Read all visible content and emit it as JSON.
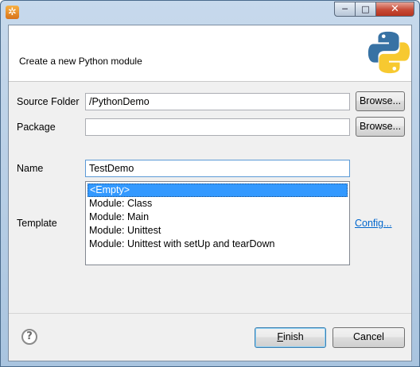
{
  "window": {
    "title": "",
    "controls": {
      "minimize": "─",
      "maximize": "□",
      "close": "✕"
    },
    "app_icon_glyph": "✲"
  },
  "header": {
    "title": "Create a new Python module",
    "logo_icon": "python-logo-icon"
  },
  "form": {
    "source_folder": {
      "label": "Source Folder",
      "value": "/PythonDemo",
      "browse": "Browse..."
    },
    "package": {
      "label": "Package",
      "value": "",
      "browse": "Browse..."
    },
    "name": {
      "label": "Name",
      "value": "TestDemo"
    },
    "template": {
      "label": "Template",
      "options": [
        "<Empty>",
        "Module: Class",
        "Module: Main",
        "Module: Unittest",
        "Module: Unittest with setUp and tearDown"
      ],
      "selected_index": 0,
      "config_link": "Config..."
    }
  },
  "footer": {
    "help_glyph": "?",
    "finish_label": "Finish",
    "cancel_label": "Cancel"
  },
  "colors": {
    "selection": "#3399ff",
    "link": "#0066cc",
    "python_blue": "#3772a4",
    "python_yellow": "#f7c930"
  }
}
